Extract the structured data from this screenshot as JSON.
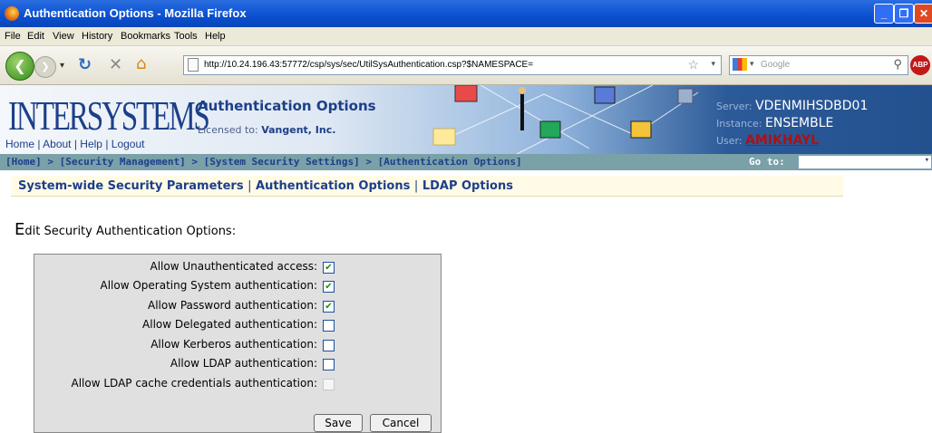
{
  "window": {
    "title": "Authentication Options - Mozilla Firefox"
  },
  "menu": [
    "File",
    "Edit",
    "View",
    "History",
    "Bookmarks",
    "Tools",
    "Help"
  ],
  "nav": {
    "url": "http://10.24.196.43:57772/csp/sys/sec/UtilSysAuthentication.csp?$NAMESPACE=",
    "search_placeholder": "Google",
    "abp": "ABP"
  },
  "header": {
    "logo": "INTERSYSTEMS",
    "links": [
      "Home",
      "About",
      "Help",
      "Logout"
    ],
    "title": "Authentication Options",
    "licensed_label": "Licensed to:",
    "licensed_value": "Vangent, Inc.",
    "server_label": "Server:",
    "server_value": "VDENMIHSDBD01",
    "instance_label": "Instance:",
    "instance_value": "ENSEMBLE",
    "user_label": "User:",
    "user_value": "AMIKHAYL"
  },
  "breadcrumb": {
    "items": [
      "[Home]",
      "[Security Management]",
      "[System Security Settings]",
      "[Authentication Options]"
    ],
    "sep": " > ",
    "goto_label": "Go to:"
  },
  "subnav": {
    "items": [
      "System-wide Security Parameters",
      "Authentication Options",
      "LDAP Options"
    ],
    "sep": "|"
  },
  "heading": {
    "first": "E",
    "rest": "dit Security Authentication Options:"
  },
  "form": {
    "rows": [
      {
        "label": "Allow Unauthenticated access:",
        "checked": true,
        "enabled": true
      },
      {
        "label": "Allow Operating System authentication:",
        "checked": true,
        "enabled": true
      },
      {
        "label": "Allow Password authentication:",
        "checked": true,
        "enabled": true
      },
      {
        "label": "Allow Delegated authentication:",
        "checked": false,
        "enabled": true
      },
      {
        "label": "Allow Kerberos authentication:",
        "checked": false,
        "enabled": true
      },
      {
        "label": "Allow LDAP authentication:",
        "checked": false,
        "enabled": true
      },
      {
        "label": "Allow LDAP cache credentials authentication:",
        "checked": false,
        "enabled": false
      }
    ],
    "save_label": "Save",
    "cancel_label": "Cancel"
  },
  "colors": {
    "brand": "#1c3f8a",
    "titlebar": "#0a4fd0",
    "crumb_bg": "#7aa0a8",
    "user": "#b01010"
  }
}
